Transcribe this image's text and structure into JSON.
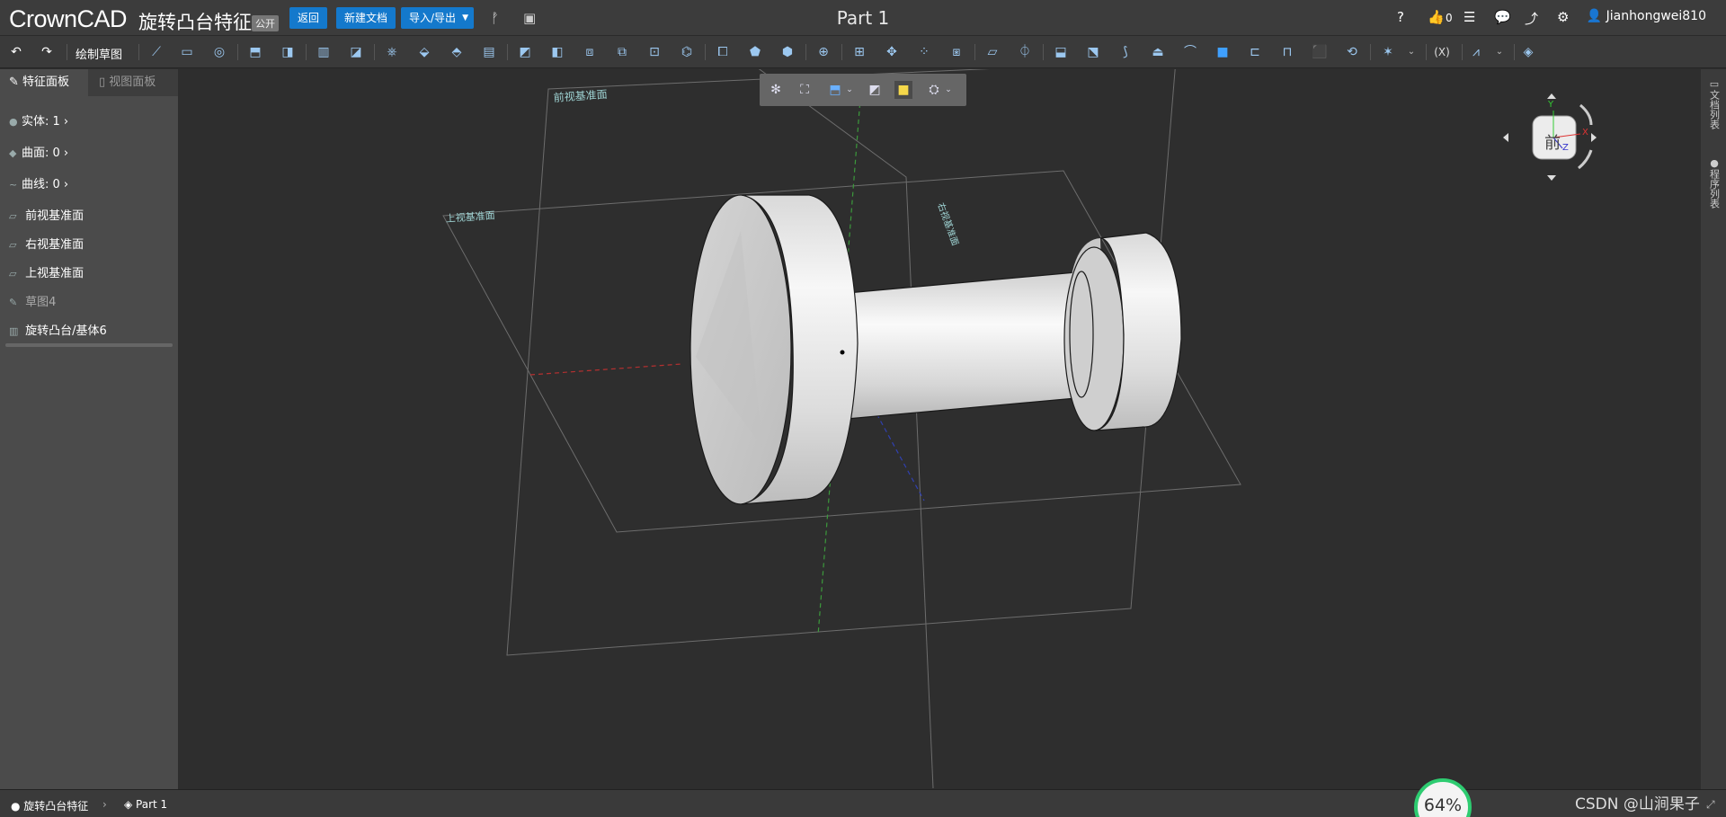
{
  "header": {
    "logo": "CrownCAD",
    "doc_title": "旋转凸台特征",
    "public_badge": "公开",
    "back_btn": "返回",
    "new_doc_btn": "新建文档",
    "import_export_btn": "导入/导出",
    "part_title": "Part 1",
    "like_count": "0",
    "username": "Jianhongwei810"
  },
  "toolbar": {
    "sketch_label": "绘制草图"
  },
  "left_panel": {
    "tabs": [
      {
        "label": "特征面板",
        "active": true
      },
      {
        "label": "视图面板",
        "active": false
      }
    ],
    "counts": [
      {
        "label": "实体: 1"
      },
      {
        "label": "曲面: 0"
      },
      {
        "label": "曲线: 0"
      }
    ],
    "tree": [
      {
        "label": "前视基准面"
      },
      {
        "label": "右视基准面"
      },
      {
        "label": "上视基准面"
      },
      {
        "label": "草图4"
      },
      {
        "label": "旋转凸台/基体6"
      }
    ]
  },
  "viewport": {
    "plane_front": "前视基准面",
    "plane_top": "上视基准面",
    "plane_right": "右视基准面",
    "viewcube_face": "前",
    "axis_x": "X",
    "axis_y": "Y",
    "axis_z": "Z"
  },
  "right_strip": {
    "doc_list": "文档列表",
    "prog_list": "程序列表"
  },
  "status": {
    "crumb1": "旋转凸台特征",
    "crumb2": "Part 1",
    "zoom": "64%",
    "watermark": "CSDN @山涧果子"
  },
  "colors": {
    "accent": "#1479cc",
    "zoom_ring": "#2ecc71"
  }
}
